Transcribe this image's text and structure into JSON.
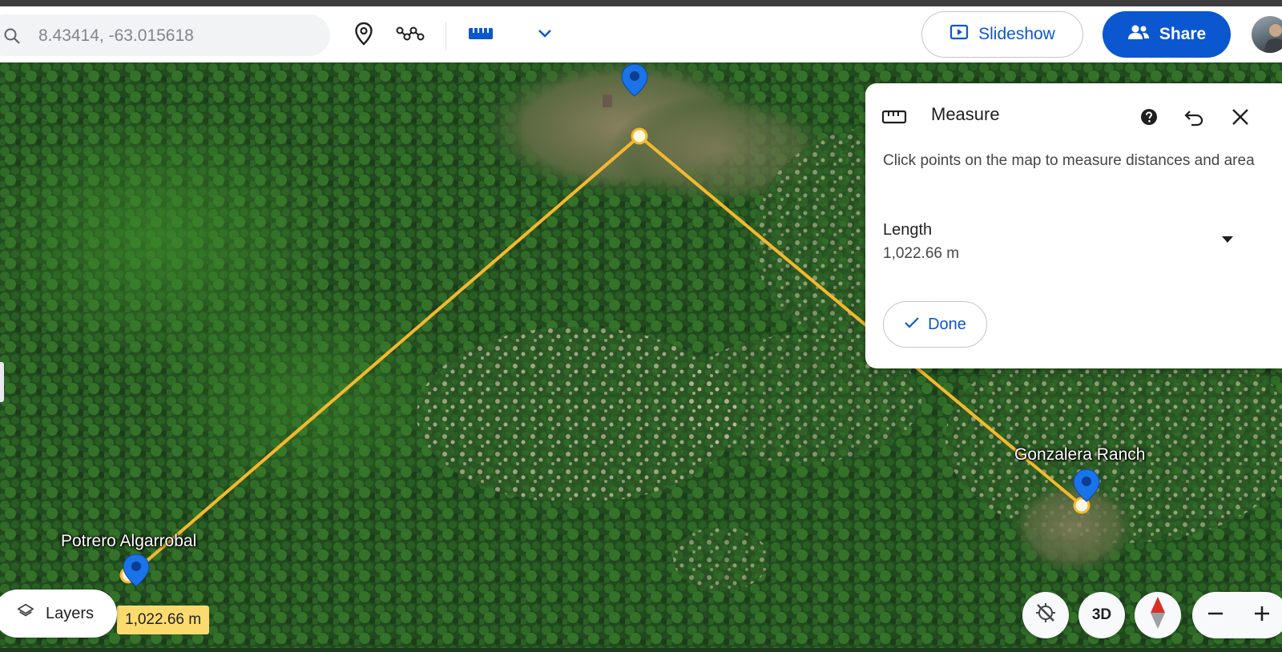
{
  "search": {
    "value": "8.43414, -63.015618",
    "icon": "search-icon"
  },
  "toolbar": {
    "icons": [
      "place-pin-icon",
      "path-icon",
      "ruler-icon",
      "chevron-down-icon"
    ],
    "slideshow_label": "Slideshow",
    "share_label": "Share",
    "accent": "#0b57d0"
  },
  "measure_panel": {
    "title": "Measure",
    "description": "Click points on the map to measure distances and area",
    "length_label": "Length",
    "length_value": "1,022.66 m",
    "done_label": "Done",
    "icons": [
      "ruler-icon",
      "help-icon",
      "undo-icon",
      "close-icon",
      "caret-down-icon",
      "check-icon"
    ]
  },
  "map": {
    "places": [
      {
        "name": "Potrero Algarrobal"
      },
      {
        "name": "Gonzalera Ranch"
      }
    ],
    "measure_line_color": "#f5b82e",
    "measure_badge": "1,022.66 m",
    "layers_label": "Layers",
    "view_3d_label": "3D",
    "controls": [
      "no-tilt-icon",
      "compass-icon",
      "zoom-out-icon",
      "zoom-in-icon"
    ]
  }
}
